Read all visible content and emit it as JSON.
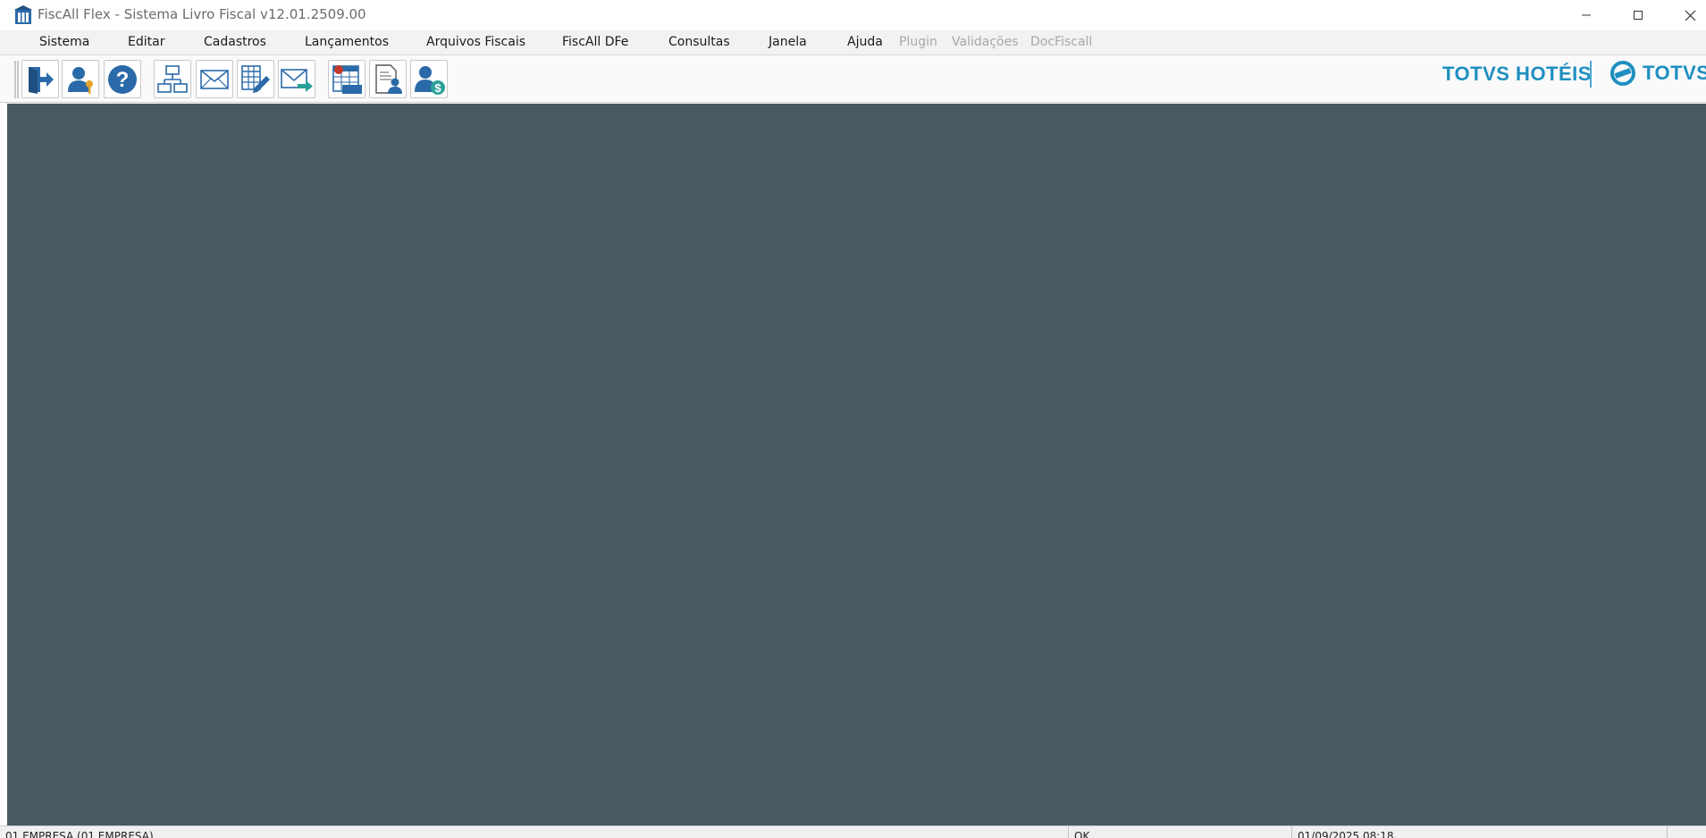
{
  "window": {
    "title": "FiscAll Flex - Sistema Livro Fiscal v12.01.2509.00"
  },
  "menu": {
    "items": [
      {
        "label": "Sistema",
        "enabled": true
      },
      {
        "label": "Editar",
        "enabled": true
      },
      {
        "label": "Cadastros",
        "enabled": true
      },
      {
        "label": "Lançamentos",
        "enabled": true
      },
      {
        "label": "Arquivos Fiscais",
        "enabled": true
      },
      {
        "label": "FiscAll DFe",
        "enabled": true
      },
      {
        "label": "Consultas",
        "enabled": true
      },
      {
        "label": "Janela",
        "enabled": true
      },
      {
        "label": "Ajuda",
        "enabled": true
      },
      {
        "label": "Plugin",
        "enabled": false
      },
      {
        "label": "Validações",
        "enabled": false
      },
      {
        "label": "DocFiscall",
        "enabled": false
      }
    ]
  },
  "toolbar": {
    "buttons": [
      {
        "icon": "exit-door-icon"
      },
      {
        "icon": "user-key-icon"
      },
      {
        "icon": "help-icon"
      },
      {
        "icon": "org-chart-icon"
      },
      {
        "icon": "envelope-icon"
      },
      {
        "icon": "spreadsheet-edit-icon"
      },
      {
        "icon": "envelope-send-icon"
      },
      {
        "icon": "icms-table-icon"
      },
      {
        "icon": "document-user-icon"
      },
      {
        "icon": "user-money-icon"
      }
    ],
    "brand_left": "TOTVS HOTÉIS",
    "brand_right": "TOTVS"
  },
  "colors": {
    "workspace": "#4a5961",
    "brand": "#1f8fc1",
    "icon_blue": "#2b6aa8"
  },
  "statusbar": {
    "panels": [
      "01 EMPRESA (01 EMPRESA)",
      "OK",
      "01/09/2025 08:18"
    ]
  }
}
